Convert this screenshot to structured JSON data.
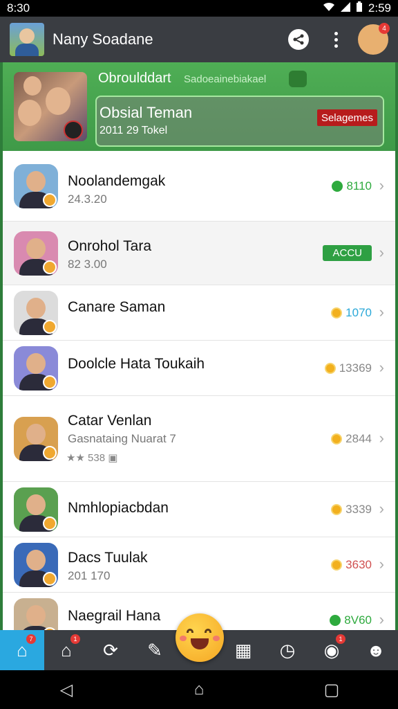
{
  "status": {
    "time_left": "8:30",
    "time_right": "2:59"
  },
  "header": {
    "title": "Nany Soadane",
    "mascot_badge": "4"
  },
  "group": {
    "name": "Obroulddart",
    "subtitle": "Sadoeainebiakael",
    "card_title": "Obsial Teman",
    "card_sub": "2011 29  Tokel",
    "card_button": "Selagemes"
  },
  "list": [
    {
      "name": "Noolandemgak",
      "sub": "24.3.20",
      "points": "8110",
      "coin": "green",
      "points_color": "#2eaa3e",
      "avatar_bg": "#7fb0d8"
    },
    {
      "name": "Onrohol Tara",
      "sub": "82 3.00",
      "pill": "ACCU",
      "avatar_bg": "#d98ab0"
    },
    {
      "name": "Canare Saman",
      "points": "1070",
      "coin": "gold",
      "points_color": "#2aa8d8",
      "avatar_bg": "#dcdcdc"
    },
    {
      "name": "Doolcle Hata Toukaih",
      "points": "13369",
      "coin": "gold",
      "points_color": "#888888",
      "avatar_bg": "#8a8ad8"
    },
    {
      "name": "Catar Venlan",
      "sub": "Gasnataing Nuarat 7",
      "stars": "★★ 538 ▣",
      "points": "2844",
      "coin": "gold",
      "points_color": "#888888",
      "avatar_bg": "#d8a050"
    },
    {
      "name": "Nmhlopiacbdan",
      "points": "3339",
      "coin": "gold",
      "points_color": "#888888",
      "avatar_bg": "#5aa050"
    },
    {
      "name": "Dacs Tuulak",
      "sub": "201 170",
      "points": "3630",
      "coin": "gold",
      "points_color": "#d05050",
      "avatar_bg": "#3a6ab8"
    },
    {
      "name": "Naegrail Hana",
      "points": "8V60",
      "coin": "green",
      "points_color": "#2eaa3e",
      "avatar_bg": "#c8b090"
    }
  ],
  "tabs": [
    {
      "icon": "home-icon",
      "glyph": "⌂",
      "badge": "7",
      "active": true
    },
    {
      "icon": "house-icon",
      "glyph": "⌂",
      "badge": "1"
    },
    {
      "icon": "refresh-icon",
      "glyph": "⟳"
    },
    {
      "icon": "note-icon",
      "glyph": "✎"
    },
    {
      "icon": "emoji-icon",
      "glyph": ""
    },
    {
      "icon": "grid-icon",
      "glyph": "▦"
    },
    {
      "icon": "clock-icon",
      "glyph": "◷"
    },
    {
      "icon": "eye-icon",
      "glyph": "◉",
      "badge": "1"
    },
    {
      "icon": "profile-icon",
      "glyph": "☻"
    }
  ],
  "nav": {
    "back": "◁",
    "home": "⌂",
    "recent": "▢"
  }
}
